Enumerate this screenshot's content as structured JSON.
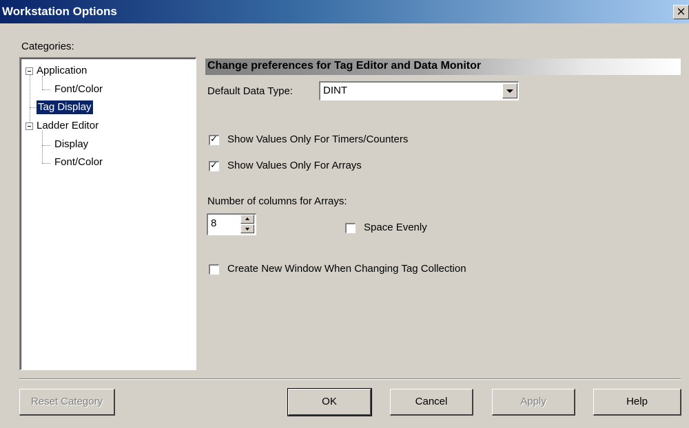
{
  "window": {
    "title": "Workstation Options",
    "close_label": "×"
  },
  "categories": {
    "label": "Categories:",
    "items": [
      {
        "label": "Application"
      },
      {
        "label": "Font/Color"
      },
      {
        "label": "Tag Display"
      },
      {
        "label": "Ladder Editor"
      },
      {
        "label": "Display"
      },
      {
        "label": "Font/Color"
      }
    ],
    "selected": "Tag Display"
  },
  "panel": {
    "header": "Change preferences for Tag Editor and Data Monitor",
    "default_data_type_label": "Default Data Type:",
    "default_data_type_value": "DINT",
    "show_timers_label": "Show Values Only For Timers/Counters",
    "show_timers_checked": true,
    "show_arrays_label": "Show Values Only For Arrays",
    "show_arrays_checked": true,
    "columns_label": "Number of columns for Arrays:",
    "columns_value": "8",
    "space_evenly_label": "Space Evenly",
    "space_evenly_checked": false,
    "new_window_label": "Create New Window When Changing Tag Collection",
    "new_window_checked": false
  },
  "buttons": {
    "reset": "Reset Category",
    "ok": "OK",
    "cancel": "Cancel",
    "apply": "Apply",
    "help": "Help"
  },
  "colors": {
    "title_gradient_start": "#0a246a",
    "title_gradient_end": "#a6caf0",
    "dialog_face": "#d4d0c8",
    "selection": "#0a246a"
  }
}
